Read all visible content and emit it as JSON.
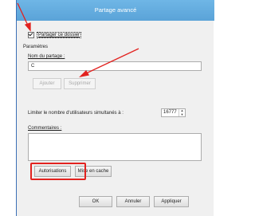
{
  "window": {
    "title": "Partage avancé"
  },
  "share": {
    "checkbox_label": "Partager ce dossier",
    "checked": true
  },
  "settings": {
    "group_label": "Paramètres",
    "share_name_label": "Nom du partage :",
    "share_name_value": "C",
    "add_label": "Ajouter",
    "remove_label": "Supprimer",
    "limit_label": "Limiter le nombre d'utilisateurs simultanés à :",
    "limit_value": "16777",
    "comments_label": "Commentaires :",
    "comments_value": ""
  },
  "buttons": {
    "permissions": "Autorisations",
    "caching": "Mise en cache",
    "ok": "OK",
    "cancel": "Annuler",
    "apply": "Appliquer"
  },
  "colors": {
    "titlebar": "#5aa3d8",
    "annotation": "#e2221f"
  }
}
